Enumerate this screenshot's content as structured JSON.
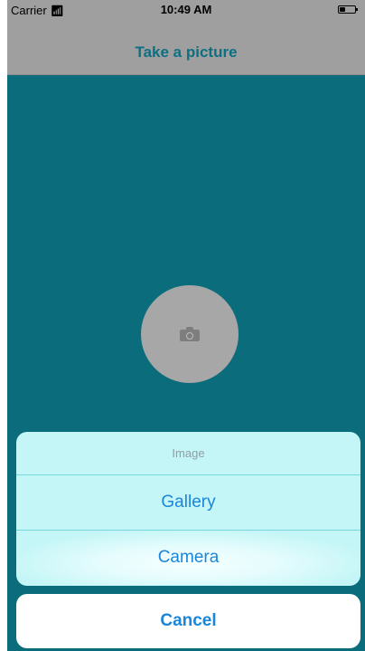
{
  "status_bar": {
    "carrier": "Carrier",
    "wifi_icon": "wifi-icon",
    "time": "10:49 AM",
    "battery_level": 0.35
  },
  "nav": {
    "title": "Take a picture"
  },
  "main": {
    "camera_icon": "camera-icon"
  },
  "action_sheet": {
    "title": "Image",
    "options": [
      {
        "label": "Gallery"
      },
      {
        "label": "Camera"
      }
    ],
    "cancel_label": "Cancel"
  },
  "colors": {
    "background": "#0b6d7c",
    "nav_bar": "#9f9f9f",
    "title_text": "#0d6f82",
    "sheet_background": "#c5f6f7",
    "action_text": "#1a86d9"
  }
}
